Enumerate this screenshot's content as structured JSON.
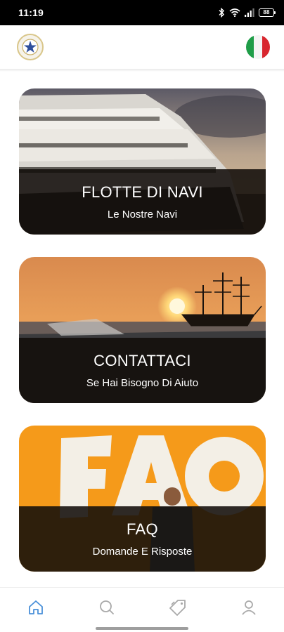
{
  "status_bar": {
    "time": "11:19",
    "battery": "88"
  },
  "header": {
    "logo_icon": "star-emblem-icon",
    "language_flag": "italian-flag-icon"
  },
  "cards": [
    {
      "title": "FLOTTE DI NAVI",
      "subtitle": "Le Nostre Navi",
      "image": "yacht-photo"
    },
    {
      "title": "CONTATTACI",
      "subtitle": "Se Hai Bisogno Di Aiuto",
      "image": "sailing-ship-sunset-photo"
    },
    {
      "title": "FAQ",
      "subtitle": "Domande E Risposte",
      "image": "faq-wall-photo"
    }
  ],
  "bottom_nav": [
    {
      "icon": "home-icon",
      "active": true
    },
    {
      "icon": "search-icon",
      "active": false
    },
    {
      "icon": "tag-icon",
      "active": false
    },
    {
      "icon": "user-icon",
      "active": false
    }
  ],
  "colors": {
    "active": "#4a90d9",
    "inactive": "#a9a9a9",
    "faq_orange": "#f59a1a"
  }
}
